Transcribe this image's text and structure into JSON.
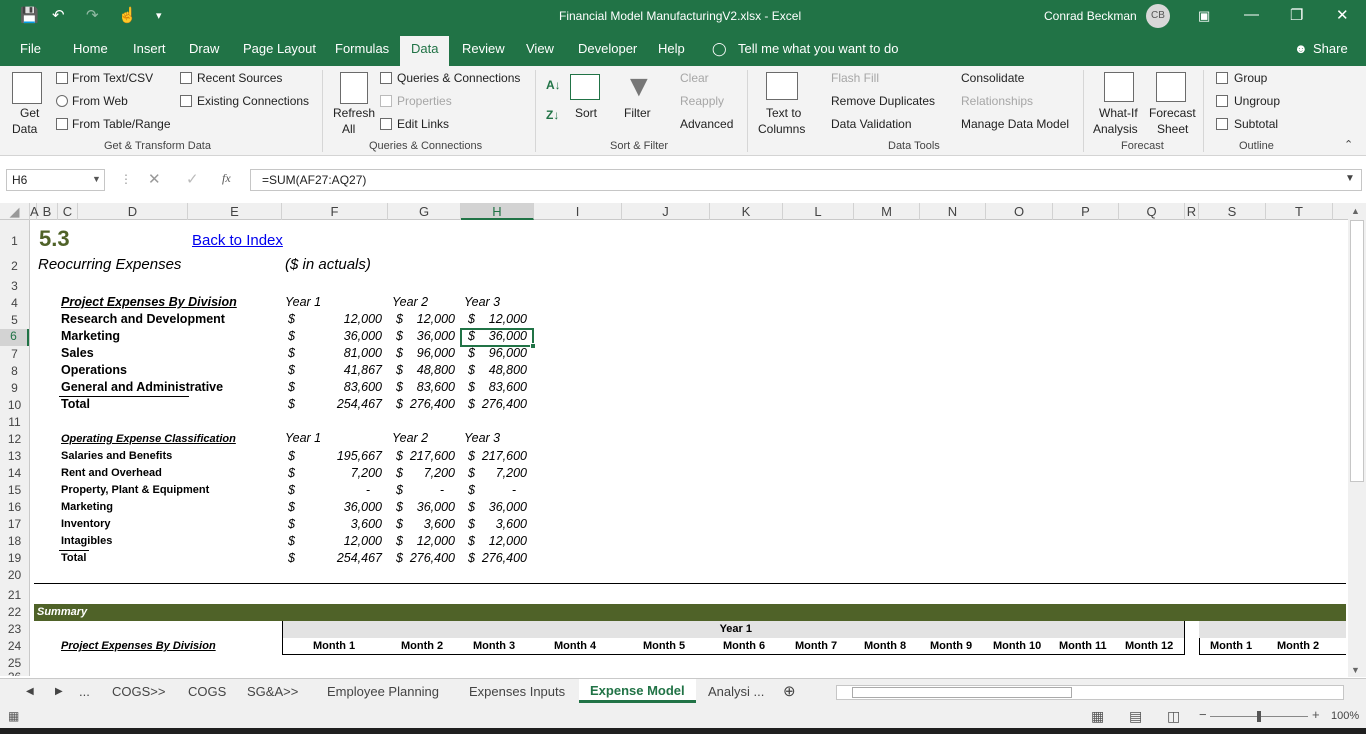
{
  "window": {
    "title": "Financial Model ManufacturingV2.xlsx  -  Excel",
    "user": "Conrad Beckman",
    "user_initials": "CB"
  },
  "tabs": [
    "File",
    "Home",
    "Insert",
    "Draw",
    "Page Layout",
    "Formulas",
    "Data",
    "Review",
    "View",
    "Developer",
    "Help"
  ],
  "tell_me": "Tell me what you want to do",
  "share": "Share",
  "ribbon": {
    "get_data": [
      "Get",
      "Data"
    ],
    "get_transform": [
      "From Text/CSV",
      "From Web",
      "From Table/Range",
      "Recent Sources",
      "Existing Connections"
    ],
    "group_get": "Get & Transform Data",
    "refresh": [
      "Refresh",
      "All"
    ],
    "queries": [
      "Queries & Connections",
      "Properties",
      "Edit Links"
    ],
    "group_queries": "Queries & Connections",
    "sort": "Sort",
    "filter": "Filter",
    "clear": "Clear",
    "reapply": "Reapply",
    "advanced": "Advanced",
    "group_sort": "Sort & Filter",
    "text_to_columns": [
      "Text to",
      "Columns"
    ],
    "flash_fill": "Flash Fill",
    "remove_duplicates": "Remove Duplicates",
    "data_validation": "Data Validation",
    "consolidate": "Consolidate",
    "relationships": "Relationships",
    "manage_model": "Manage Data Model",
    "group_tools": "Data Tools",
    "what_if": [
      "What-If",
      "Analysis"
    ],
    "forecast_sheet": [
      "Forecast",
      "Sheet"
    ],
    "group_forecast": "Forecast",
    "group": "Group",
    "ungroup": "Ungroup",
    "subtotal": "Subtotal",
    "group_outline": "Outline"
  },
  "namebox": "H6",
  "formula": "=SUM(AF27:AQ27)",
  "columns": [
    "A",
    "B",
    "C",
    "D",
    "E",
    "F",
    "G",
    "H",
    "I",
    "J",
    "K",
    "L",
    "M",
    "N",
    "O",
    "P",
    "Q",
    "R",
    "S",
    "T"
  ],
  "rows": [
    "1",
    "2",
    "3",
    "4",
    "5",
    "6",
    "7",
    "8",
    "9",
    "10",
    "11",
    "12",
    "13",
    "14",
    "15",
    "16",
    "17",
    "18",
    "19",
    "20",
    "21",
    "22",
    "23",
    "24",
    "25",
    "26"
  ],
  "sheet": {
    "section": "5.3",
    "back_link": "Back to Index",
    "subtitle": "Reocurring Expenses",
    "units": "($ in actuals)",
    "t1": {
      "header": "Project Expenses By Division",
      "years": [
        "Year 1",
        "Year 2",
        "Year 3"
      ],
      "rows": [
        {
          "label": "Research and Development",
          "v": [
            "12,000",
            "12,000",
            "12,000"
          ]
        },
        {
          "label": "Marketing",
          "v": [
            "36,000",
            "36,000",
            "36,000"
          ]
        },
        {
          "label": "Sales",
          "v": [
            "81,000",
            "96,000",
            "96,000"
          ]
        },
        {
          "label": "Operations",
          "v": [
            "41,867",
            "48,800",
            "48,800"
          ]
        },
        {
          "label": "General and Administrative",
          "v": [
            "83,600",
            "83,600",
            "83,600"
          ]
        },
        {
          "label": "Total",
          "v": [
            "254,467",
            "276,400",
            "276,400"
          ]
        }
      ]
    },
    "t2": {
      "header": "Operating Expense Classification",
      "years": [
        "Year 1",
        "Year 2",
        "Year 3"
      ],
      "rows": [
        {
          "label": "Salaries and Benefits",
          "v": [
            "195,667",
            "217,600",
            "217,600"
          ]
        },
        {
          "label": "Rent and Overhead",
          "v": [
            "7,200",
            "7,200",
            "7,200"
          ]
        },
        {
          "label": "Property, Plant & Equipment",
          "v": [
            "-",
            "-",
            "-"
          ]
        },
        {
          "label": "Marketing",
          "v": [
            "36,000",
            "36,000",
            "36,000"
          ]
        },
        {
          "label": "Inventory",
          "v": [
            "3,600",
            "3,600",
            "3,600"
          ]
        },
        {
          "label": "Intagibles",
          "v": [
            "12,000",
            "12,000",
            "12,000"
          ]
        },
        {
          "label": "Total",
          "v": [
            "254,467",
            "276,400",
            "276,400"
          ]
        }
      ]
    },
    "currency": "$",
    "summary_label": "Summary",
    "year_band": "Year 1",
    "summary_header": "Project Expenses By Division",
    "months": [
      "Month 1",
      "Month 2",
      "Month 3",
      "Month 4",
      "Month 5",
      "Month 6",
      "Month 7",
      "Month 8",
      "Month 9",
      "Month 10",
      "Month 11",
      "Month 12"
    ],
    "months_y2": [
      "Month 1",
      "Month 2"
    ]
  },
  "sheet_tabs": [
    "...",
    "COGS>>",
    "COGS",
    "SG&A>>",
    "Employee Planning",
    "Expenses Inputs",
    "Expense Model",
    "Analysi ..."
  ],
  "active_sheet": "Expense Model",
  "zoom": "100%",
  "colors": {
    "accent": "#217346",
    "summary_band": "#4f6228"
  }
}
